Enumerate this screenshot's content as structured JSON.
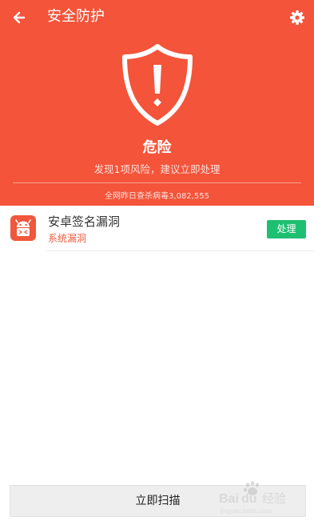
{
  "header": {
    "title": "安全防护",
    "status": "危险",
    "subtitle": "发现1项风险，建议立即处理",
    "stats": "全网昨日查杀病毒3,082,555",
    "background_color": "#f3543a"
  },
  "risk_list": [
    {
      "title": "安卓签名漏洞",
      "subtitle": "系统漏洞",
      "action_label": "处理",
      "icon": "android-icon"
    }
  ],
  "footer": {
    "scan_label": "立即扫描"
  },
  "icons": {
    "back": "arrow-left-icon",
    "settings": "gear-icon",
    "shield": "shield-warning-icon",
    "item": "android-icon"
  },
  "colors": {
    "danger": "#f3543a",
    "action_green": "#1fbf72",
    "alert_text": "#ef5a3f"
  },
  "watermark_text": "Baidu 经验"
}
